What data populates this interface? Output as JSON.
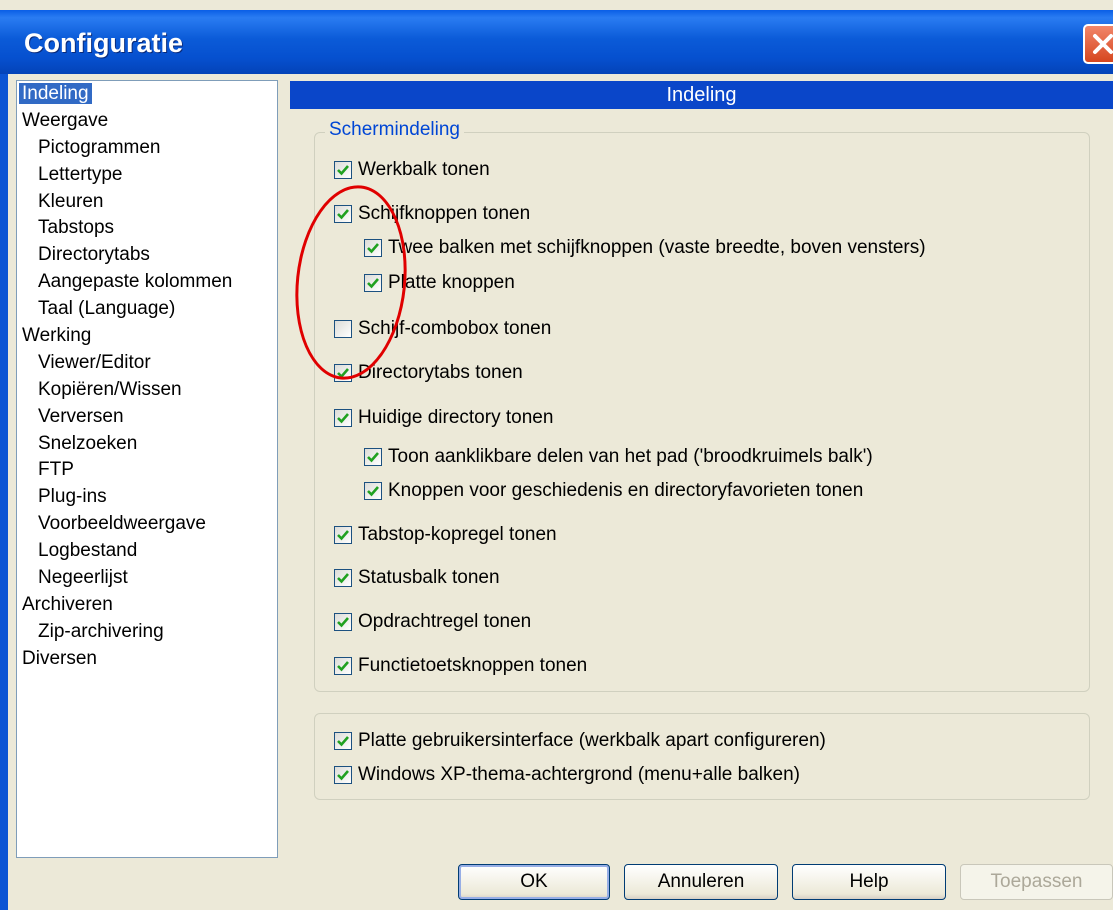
{
  "window": {
    "title": "Configuratie"
  },
  "tree": {
    "items": [
      {
        "label": "Indeling",
        "level": 0,
        "selected": true
      },
      {
        "label": "Weergave",
        "level": 0
      },
      {
        "label": "Pictogrammen",
        "level": 1
      },
      {
        "label": "Lettertype",
        "level": 1
      },
      {
        "label": "Kleuren",
        "level": 1
      },
      {
        "label": "Tabstops",
        "level": 1
      },
      {
        "label": "Directorytabs",
        "level": 1
      },
      {
        "label": "Aangepaste kolommen",
        "level": 1
      },
      {
        "label": "Taal (Language)",
        "level": 1
      },
      {
        "label": "Werking",
        "level": 0
      },
      {
        "label": "Viewer/Editor",
        "level": 1
      },
      {
        "label": "Kopiëren/Wissen",
        "level": 1
      },
      {
        "label": "Verversen",
        "level": 1
      },
      {
        "label": "Snelzoeken",
        "level": 1
      },
      {
        "label": "FTP",
        "level": 1
      },
      {
        "label": "Plug-ins",
        "level": 1
      },
      {
        "label": "Voorbeeldweergave",
        "level": 1
      },
      {
        "label": "Logbestand",
        "level": 1
      },
      {
        "label": "Negeerlijst",
        "level": 1
      },
      {
        "label": "Archiveren",
        "level": 0
      },
      {
        "label": "Zip-archivering",
        "level": 1
      },
      {
        "label": "Diversen",
        "level": 0
      }
    ]
  },
  "panel": {
    "header": "Indeling",
    "group1": {
      "legend": "Schermindeling",
      "options": [
        {
          "label": "Werkbalk tonen",
          "checked": true
        },
        {
          "label": "Schijfknoppen tonen",
          "checked": true
        },
        {
          "label": "Twee balken met schijfknoppen (vaste breedte, boven vensters)",
          "checked": true
        },
        {
          "label": "Platte knoppen",
          "checked": true
        },
        {
          "label": "Schijf-combobox tonen",
          "checked": false
        },
        {
          "label": "Directorytabs tonen",
          "checked": true
        },
        {
          "label": "Huidige directory tonen",
          "checked": true
        },
        {
          "label": "Toon aanklikbare delen van het pad ('broodkruimels balk')",
          "checked": true
        },
        {
          "label": "Knoppen voor geschiedenis en directoryfavorieten tonen",
          "checked": true
        },
        {
          "label": "Tabstop-kopregel tonen",
          "checked": true
        },
        {
          "label": "Statusbalk tonen",
          "checked": true
        },
        {
          "label": "Opdrachtregel tonen",
          "checked": true
        },
        {
          "label": "Functietoetsknoppen tonen",
          "checked": true
        }
      ]
    },
    "group2": {
      "options": [
        {
          "label": "Platte gebruikersinterface (werkbalk apart configureren)",
          "checked": true
        },
        {
          "label": "Windows XP-thema-achtergrond (menu+alle balken)",
          "checked": true
        }
      ]
    }
  },
  "buttons": {
    "ok": "OK",
    "cancel": "Annuleren",
    "help": "Help",
    "apply": "Toepassen"
  },
  "colors": {
    "titlebar": "#0b5bd8",
    "selection": "#316ac5",
    "header": "#0a46c9",
    "check": "#21a121",
    "annotation": "#e00000"
  }
}
